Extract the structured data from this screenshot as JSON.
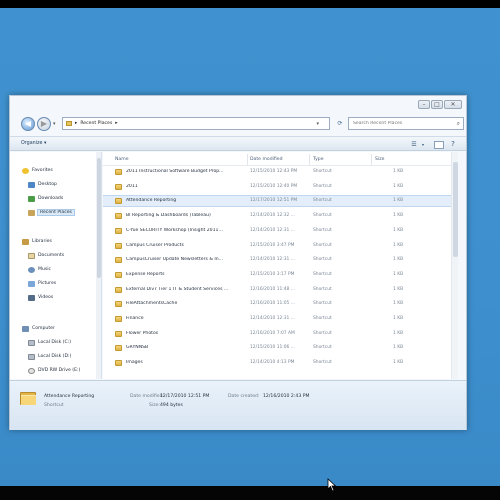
{
  "window": {
    "address": {
      "location": "Recent Places",
      "separator": "▸"
    },
    "search": {
      "placeholder": "Search Recent Places"
    },
    "toolbar": {
      "organize_label": "Organize ▾"
    },
    "nav_pane": {
      "favorites": {
        "header": "Favorites",
        "items": [
          "Desktop",
          "Downloads",
          "Recent Places"
        ]
      },
      "libraries": {
        "header": "Libraries",
        "items": [
          "Documents",
          "Music",
          "Pictures",
          "Videos"
        ]
      },
      "computer": {
        "header": "Computer",
        "items": [
          "Local Disk (C:)",
          "Local Disk (D:)",
          "DVD RW Drive (E:)"
        ]
      }
    },
    "columns": {
      "name": "Name",
      "date": "Date modified",
      "type": "Type",
      "size": "Size"
    },
    "files": [
      {
        "name": "2011 Instructional Software Budget Prop...",
        "date": "12/15/2010 12:43 PM",
        "type": "Shortcut",
        "size": "1 KB"
      },
      {
        "name": "2011",
        "date": "12/15/2010 12:40 PM",
        "type": "Shortcut",
        "size": "1 KB"
      },
      {
        "name": "Attendance Reporting",
        "date": "12/17/2010 12:51 PM",
        "type": "Shortcut",
        "size": "1 KB"
      },
      {
        "name": "BI Reporting & Dashboards (Tableau)",
        "date": "12/14/2010 12:32 ...",
        "type": "Shortcut",
        "size": "1 KB"
      },
      {
        "name": "C-Yue SECURITY Workshop (Insight 2011...",
        "date": "12/14/2010 12:31 ...",
        "type": "Shortcut",
        "size": "1 KB"
      },
      {
        "name": "Campus Cruiser Products",
        "date": "12/15/2010 3:47 PM",
        "type": "Shortcut",
        "size": "1 KB"
      },
      {
        "name": "CampusCruiser Update Newsletters & In...",
        "date": "12/14/2010 12:31 ...",
        "type": "Shortcut",
        "size": "1 KB"
      },
      {
        "name": "Expense Reports",
        "date": "12/15/2010 3:17 PM",
        "type": "Shortcut",
        "size": "1 KB"
      },
      {
        "name": "External Div7 Tier 1 IT & Student Services ...",
        "date": "12/16/2010 11:48 ...",
        "type": "Shortcut",
        "size": "1 KB"
      },
      {
        "name": "FileAttachmentsCache",
        "date": "12/16/2010 11:05 ...",
        "type": "Shortcut",
        "size": "1 KB"
      },
      {
        "name": "Finance",
        "date": "12/14/2010 12:31 ...",
        "type": "Shortcut",
        "size": "1 KB"
      },
      {
        "name": "Flower Photos",
        "date": "12/16/2010 7:07 AM",
        "type": "Shortcut",
        "size": "1 KB"
      },
      {
        "name": "GRYNNSB",
        "date": "12/15/2010 11:06 ...",
        "type": "Shortcut",
        "size": "1 KB"
      },
      {
        "name": "Images",
        "date": "12/14/2010 4:13 PM",
        "type": "Shortcut",
        "size": "1 KB"
      }
    ],
    "selected_index": 2,
    "details": {
      "name": "Attendance Reporting",
      "date_label": "Date modified:",
      "date_value": "12/17/2010 12:51 PM",
      "created_label": "Date created:",
      "created_value": "12/16/2010 2:43 PM",
      "type": "Shortcut",
      "size_label": "Size:",
      "size_value": "494 bytes"
    }
  }
}
